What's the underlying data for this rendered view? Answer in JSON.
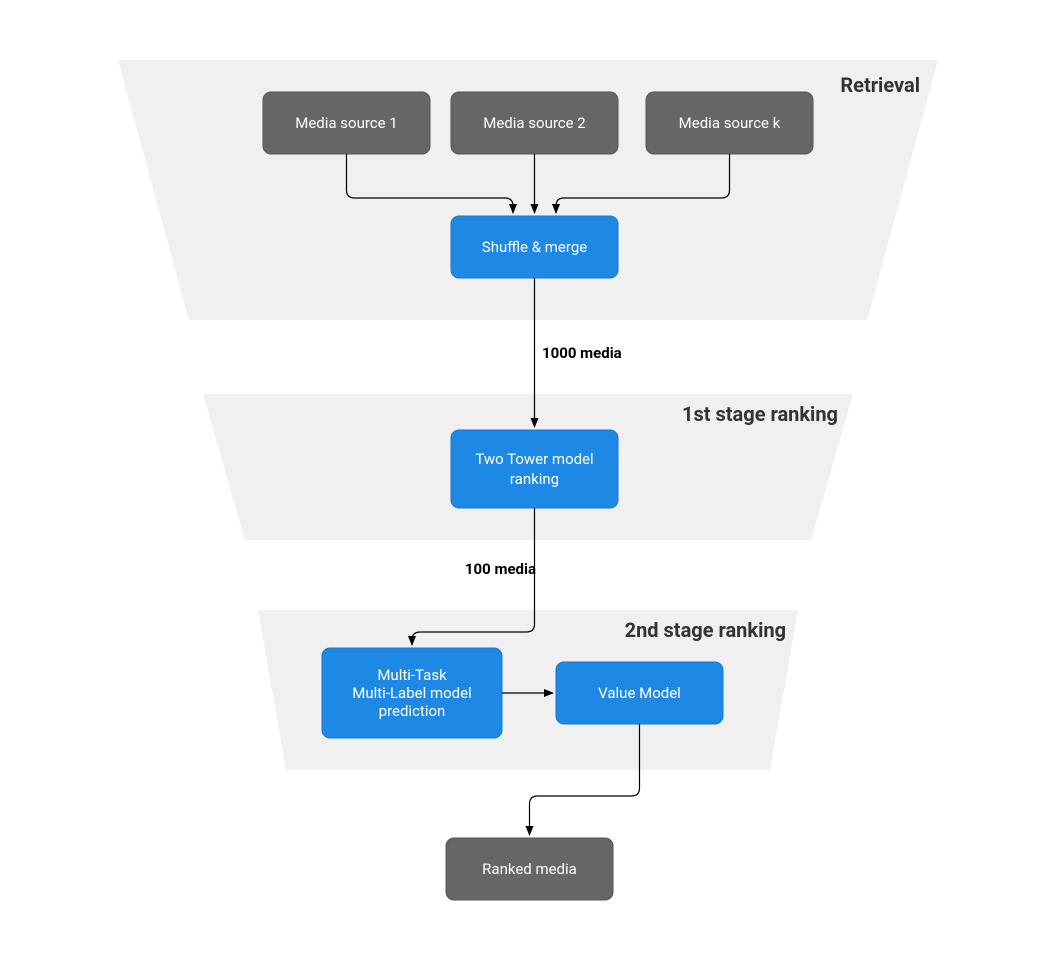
{
  "stages": {
    "retrieval": {
      "label": "Retrieval"
    },
    "stage1": {
      "label": "1st stage ranking"
    },
    "stage2": {
      "label": "2nd stage ranking"
    }
  },
  "nodes": {
    "source1": {
      "label": "Media source 1"
    },
    "source2": {
      "label": "Media source 2"
    },
    "sourcek": {
      "label": "Media source k"
    },
    "shuffle": {
      "label": "Shuffle & merge"
    },
    "twotower_l1": "Two Tower model",
    "twotower_l2": "ranking",
    "mtml_l1": "Multi-Task",
    "mtml_l2": "Multi-Label model",
    "mtml_l3": "prediction",
    "valuemodel": {
      "label": "Value Model"
    },
    "ranked": {
      "label": "Ranked media"
    }
  },
  "edges": {
    "after_shuffle": "1000 media",
    "after_twotower": "100 media"
  }
}
